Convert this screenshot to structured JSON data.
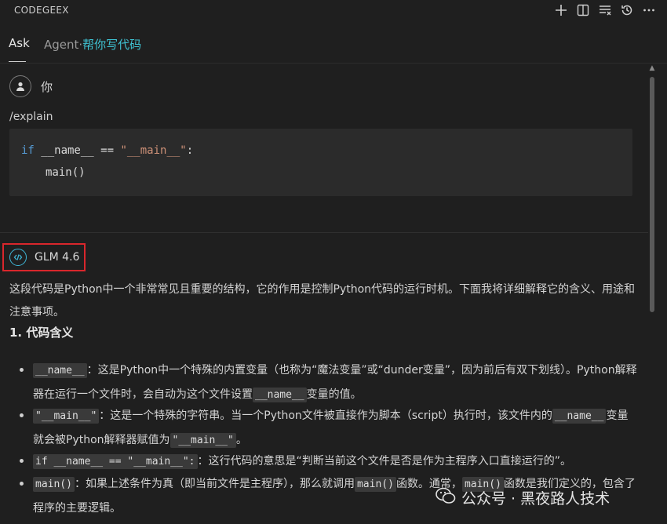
{
  "title": "CODEGEEX",
  "toolbar": {
    "icons": [
      "plus-icon",
      "split-icon",
      "list-icon",
      "history-icon",
      "more-icon"
    ]
  },
  "tabs": {
    "ask": "Ask",
    "agent": "Agent·",
    "agent_sub": "帮你写代码"
  },
  "user": {
    "name": "你",
    "command": "/explain"
  },
  "code": {
    "line1_kw": "if",
    "line1_a": " __name__ == ",
    "line1_str": "\"__main__\"",
    "line1_end": ":",
    "line2": "main()"
  },
  "model": {
    "name": "GLM 4.6"
  },
  "answer": {
    "intro": "这段代码是Python中一个非常常见且重要的结构，它的作用是控制Python代码的运行时机。下面我将详细解释它的含义、用途和注意事项。",
    "heading": "1. 代码含义"
  },
  "bullets": [
    {
      "code": "__name__",
      "text1": "：这是Python中一个特殊的内置变量（也称为“魔法变量”或“dunder变量”，因为前后有双下划线）。Python解释器在运行一个文件时，会自动为这个文件设置",
      "code2": "__name__",
      "text2": "变量的值。"
    },
    {
      "code": "\"__main__\"",
      "text1": "：这是一个特殊的字符串。当一个Python文件被直接作为脚本（script）执行时，该文件内的",
      "code2": "__name__",
      "text2": "变量就会被Python解释器赋值为",
      "code3": "\"__main__\"",
      "text3": "。"
    },
    {
      "code": "if __name__ == \"__main__\":",
      "text1": "：这行代码的意思是“判断当前这个文件是否是作为主程序入口直接运行的”。"
    },
    {
      "code": "main()",
      "text1": "：如果上述条件为真（即当前文件是主程序），那么就调用",
      "code2": "main()",
      "text2": "函数。通常，",
      "code3": "main()",
      "text3": "函数是我们定义的，包含了程序的主要逻辑。"
    }
  ],
  "watermark": {
    "text": "公众号 · 黑夜路人技术"
  }
}
